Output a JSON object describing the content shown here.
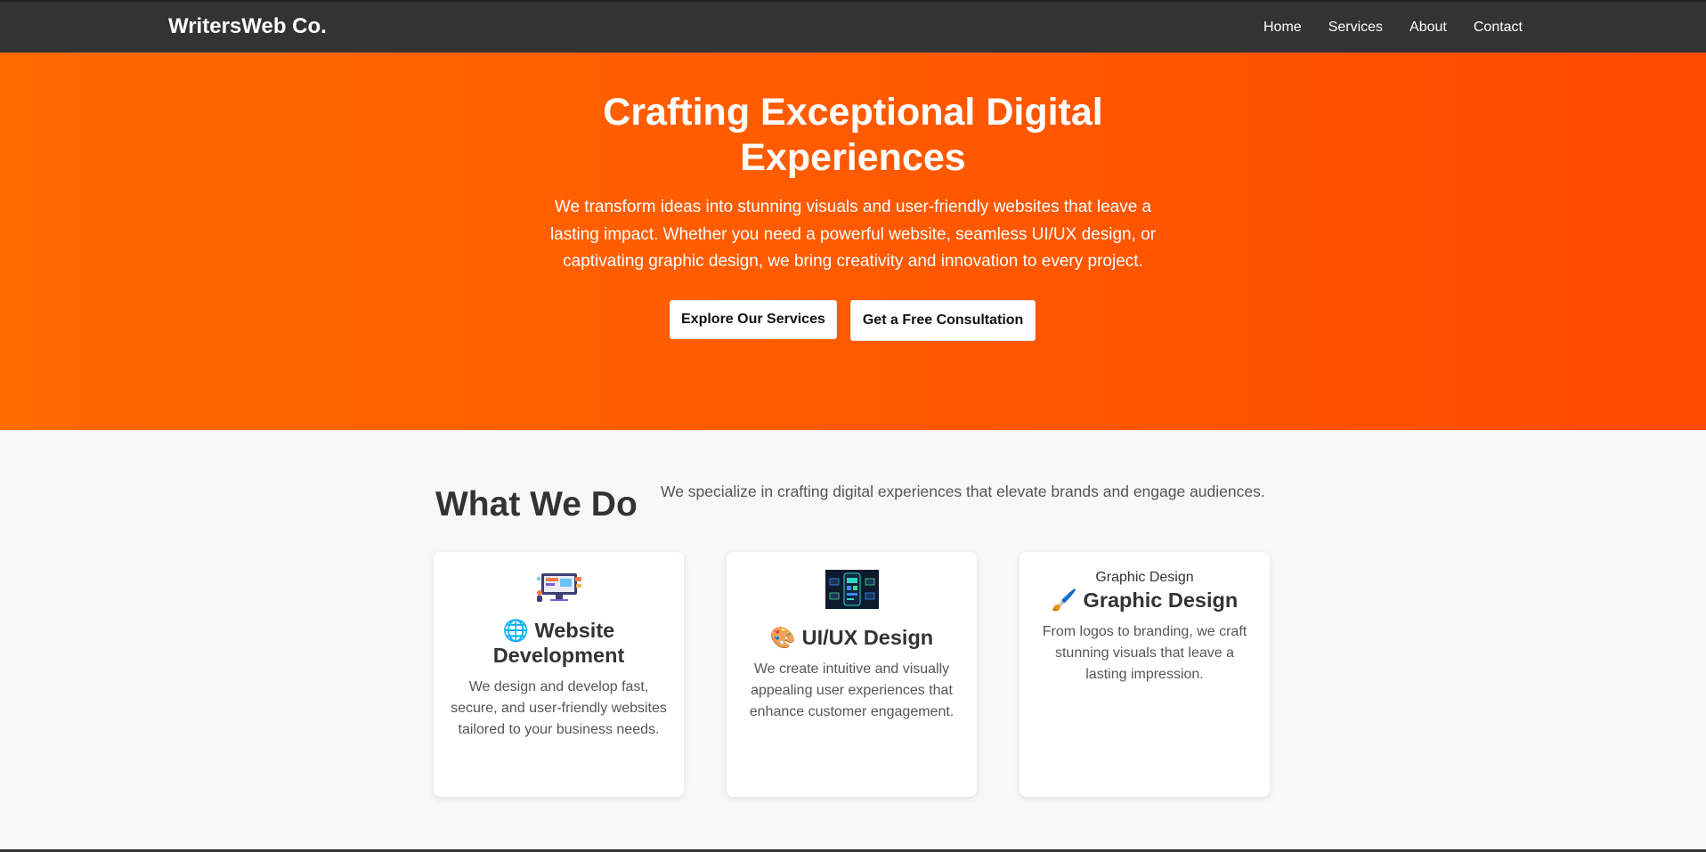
{
  "header": {
    "brand": "WritersWeb Co.",
    "nav": [
      "Home",
      "Services",
      "About",
      "Contact"
    ]
  },
  "hero": {
    "title": "Crafting Exceptional Digital Experiences",
    "subtitle": "We transform ideas into stunning visuals and user-friendly websites that leave a lasting impact. Whether you need a powerful website, seamless UI/UX design, or captivating graphic design, we bring creativity and innovation to every project.",
    "primary_button": "Explore Our Services",
    "secondary_button": "Get a Free Consultation"
  },
  "services": {
    "heading": "What We Do",
    "intro": "We specialize in crafting digital experiences that elevate brands and engage audiences.",
    "cards": [
      {
        "emoji": "🌐",
        "title": "Website Development",
        "description": "We design and develop fast, secure, and user-friendly websites tailored to your business needs."
      },
      {
        "emoji": "🎨",
        "title": "UI/UX Design",
        "description": "We create intuitive and visually appealing user experiences that enhance customer engagement."
      },
      {
        "alt_text": "Graphic Design",
        "emoji": "🖌️",
        "title": "Graphic Design",
        "description": "From logos to branding, we craft stunning visuals that leave a lasting impression."
      }
    ]
  },
  "colors": {
    "header_bg": "#333333",
    "hero_gradient_start": "#ff6a00",
    "hero_gradient_end": "#ff4a00",
    "section_bg": "#f8f8f8"
  }
}
